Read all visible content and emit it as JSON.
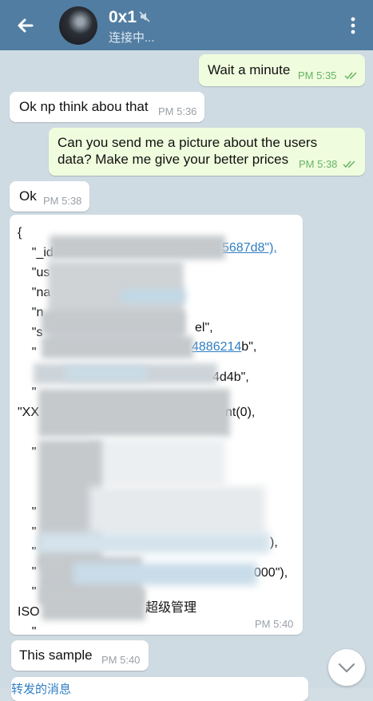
{
  "header": {
    "title": "0x1",
    "status": "连接中..."
  },
  "messages": [
    {
      "dir": "out",
      "text": "Wait a minute",
      "time": "PM 5:35"
    },
    {
      "dir": "in",
      "text": "Ok np think abou that",
      "time": "PM 5:36"
    },
    {
      "dir": "out",
      "text_line1": "Can you send me a picture about the  users",
      "text_line2": "data? Make me give your better prices",
      "time": "PM 5:38"
    },
    {
      "dir": "in",
      "text": "Ok",
      "time": "PM 5:38"
    },
    {
      "dir": "in",
      "json_lines": [
        "{",
        "    \"_id",
        "    \"us",
        "    \"na",
        "    \"n",
        "    \"s",
        "    \"",
        "",
        "    \"",
        "\"XX",
        "",
        "    \"",
        "",
        "",
        "    \"",
        "    \"",
        "    \"",
        "    \"",
        "    \"",
        "ISO",
        "    \"",
        "ISO",
        "    \"",
        "}"
      ],
      "json_fragments": {
        "id_tail": "5687d8\"),",
        "line_el": "el\",",
        "hash_link": "4886214",
        "hash_tail": "b\",",
        "xx_tail": "4d4b\",",
        "nt0": "nt(0),",
        "paren": "),",
        "sixk": "000\"),",
        "admin": "超级管理"
      },
      "time": "PM 5:40"
    },
    {
      "dir": "in",
      "text": "This sample",
      "time": "PM 5:40"
    }
  ],
  "footer_text": "转发的消息"
}
